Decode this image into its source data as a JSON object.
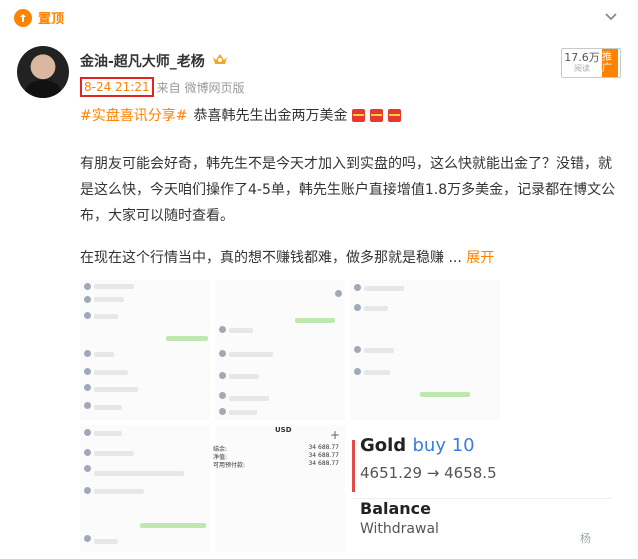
{
  "header": {
    "pin_label": "置顶"
  },
  "author": {
    "name": "金油-超凡大师_老杨",
    "time": "8-24 21:21",
    "source": "来自 微博网页版"
  },
  "stats": {
    "views": "17.6万",
    "views_label": "阅读",
    "promo_label": "推广"
  },
  "post": {
    "topic": "#实盘喜讯分享#",
    "headline": "恭喜韩先生出金两万美金",
    "para1": "有朋友可能会好奇，韩先生不是今天才加入到实盘的吗，这么快就能出金了？没错，就是这么快，今天咱们操作了4-5单，韩先生账户直接增值1.8万多美金，记录都在博文公布，大家可以随时查看。",
    "para2": "在现在这个行情当中，真的想不赚钱都难，做多那就是稳赚",
    "ellipsis": "...",
    "expand": "展开"
  },
  "screenshot_content": {
    "usd_header": "USD",
    "rows": [
      {
        "label": "结余:",
        "value": "34 688.77"
      },
      {
        "label": "净值:",
        "value": "34 688.77"
      },
      {
        "label": "可用预付款:",
        "value": "34 688.77"
      }
    ],
    "gold_title": "Gold",
    "gold_action": "buy 10",
    "gold_prices": "4651.29 → 4658.5",
    "balance_title": "Balance",
    "balance_sub": "Withdrawal",
    "watermark": "杨"
  },
  "colors": {
    "accent": "#ff8200",
    "highlight_box": "#e02424"
  }
}
